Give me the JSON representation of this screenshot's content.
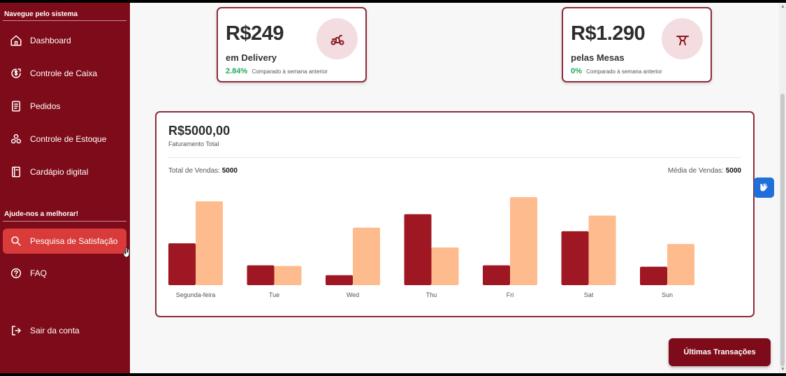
{
  "sidebar": {
    "section_nav_title": "Navegue pelo sistema",
    "nav_items": [
      {
        "label": "Dashboard",
        "icon": "home-icon"
      },
      {
        "label": "Controle de Caixa",
        "icon": "cash-register-icon"
      },
      {
        "label": "Pedidos",
        "icon": "receipt-icon"
      },
      {
        "label": "Controle de Estoque",
        "icon": "boxes-icon"
      },
      {
        "label": "Cardápio digital",
        "icon": "menu-book-icon"
      }
    ],
    "section_help_title": "Ajude-nos a melhorar!",
    "help_items": [
      {
        "label": "Pesquisa de Satisfação",
        "icon": "search-icon",
        "active": true
      },
      {
        "label": "FAQ",
        "icon": "help-circle-icon"
      }
    ],
    "logout_label": "Sair da conta",
    "colors": {
      "background": "#7e0b19",
      "active": "#d93b3b"
    }
  },
  "cards": {
    "delivery": {
      "amount": "R$249",
      "label": "em Delivery",
      "percent": "2.84%",
      "compare_text": "Comparado à semana anterior",
      "icon": "scooter-icon"
    },
    "tables": {
      "amount": "R$1.290",
      "label": "pelas Mesas",
      "percent": "0%",
      "compare_text": "Comparado à semana anterior",
      "icon": "table-icon"
    }
  },
  "revenue": {
    "total": "R$5000,00",
    "total_label": "Faturamento Total",
    "sales_label": "Total de Vendas:",
    "sales_value": "5000",
    "avg_label": "Média de Vendas:",
    "avg_value": "5000"
  },
  "chart_data": {
    "type": "bar",
    "categories": [
      "Segunda-feira",
      "Tue",
      "Wed",
      "Thu",
      "Fri",
      "Sat",
      "Sun"
    ],
    "series": [
      {
        "values": [
          59,
          28,
          14,
          100,
          28,
          76,
          26
        ],
        "color": "#9e1722"
      },
      {
        "values": [
          118,
          27,
          81,
          53,
          124,
          98,
          58
        ],
        "color": "#fdbb8e"
      }
    ],
    "ylim": [
      0,
      130
    ],
    "grid": false,
    "legend": "none"
  },
  "actions": {
    "transactions_label": "Últimas Transações"
  }
}
